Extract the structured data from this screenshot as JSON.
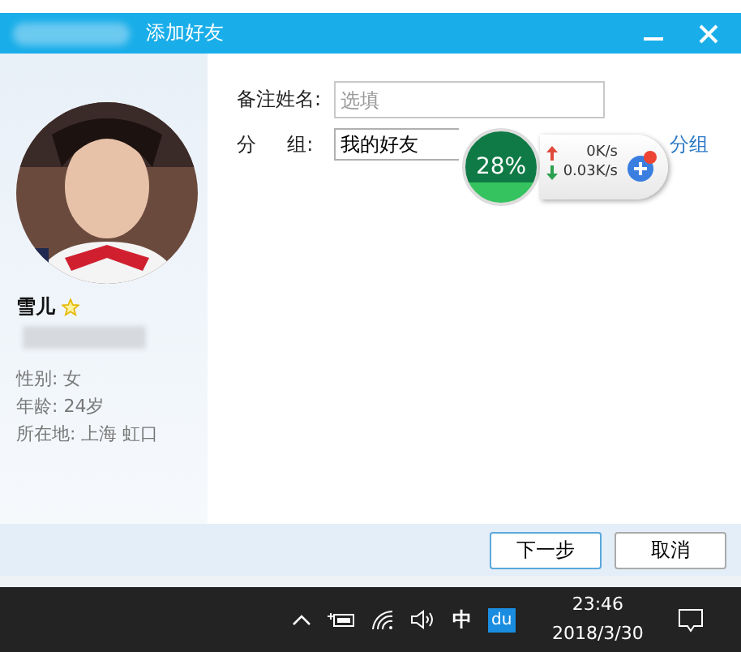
{
  "window": {
    "title": "添加好友"
  },
  "profile": {
    "name": "雪儿",
    "starred": true,
    "details": [
      "性别: 女",
      "年龄: 24岁",
      "所在地: 上海  虹口"
    ]
  },
  "form": {
    "remark": {
      "label": "备注姓名:",
      "placeholder": "选填"
    },
    "group": {
      "label": "分     组:",
      "value": "我的好友"
    },
    "new_group_link": "分组"
  },
  "speed_widget": {
    "percent": "28%",
    "upload": "0K/s",
    "download": "0.03K/s"
  },
  "buttons": [
    {
      "label": "下一步",
      "primary": true
    },
    {
      "label": "取消",
      "primary": false
    }
  ],
  "taskbar": {
    "ime": "中",
    "app_badge": "du",
    "time": "23:46",
    "date": "2018/3/30"
  }
}
